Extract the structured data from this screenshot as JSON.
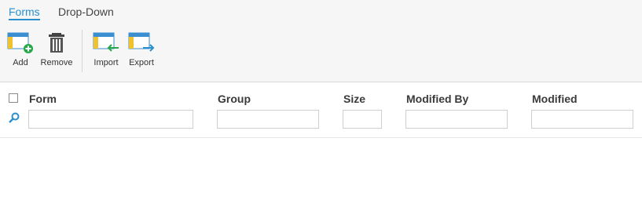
{
  "tabs": [
    {
      "label": "Forms",
      "active": true
    },
    {
      "label": "Drop-Down",
      "active": false
    }
  ],
  "toolbar": {
    "add_label": "Add",
    "remove_label": "Remove",
    "import_label": "Import",
    "export_label": "Export"
  },
  "grid": {
    "columns": [
      {
        "title": "Form",
        "filter": "",
        "placeholder": ""
      },
      {
        "title": "Group",
        "filter": "",
        "placeholder": ""
      },
      {
        "title": "Size",
        "filter": "",
        "placeholder": ""
      },
      {
        "title": "Modified By",
        "filter": "",
        "placeholder": ""
      },
      {
        "title": "Modified",
        "filter": "",
        "placeholder": ""
      }
    ]
  },
  "icons": {
    "add": "form-add-icon",
    "remove": "trash-icon",
    "import": "form-import-icon",
    "export": "form-export-icon",
    "filter": "search-icon"
  },
  "colors": {
    "accent": "#2a8fce",
    "add_green": "#27a84a",
    "import_green": "#27a84a",
    "export_blue": "#2a8fce",
    "doc_blue": "#3b8fd0",
    "doc_yellow": "#f2c12e"
  }
}
